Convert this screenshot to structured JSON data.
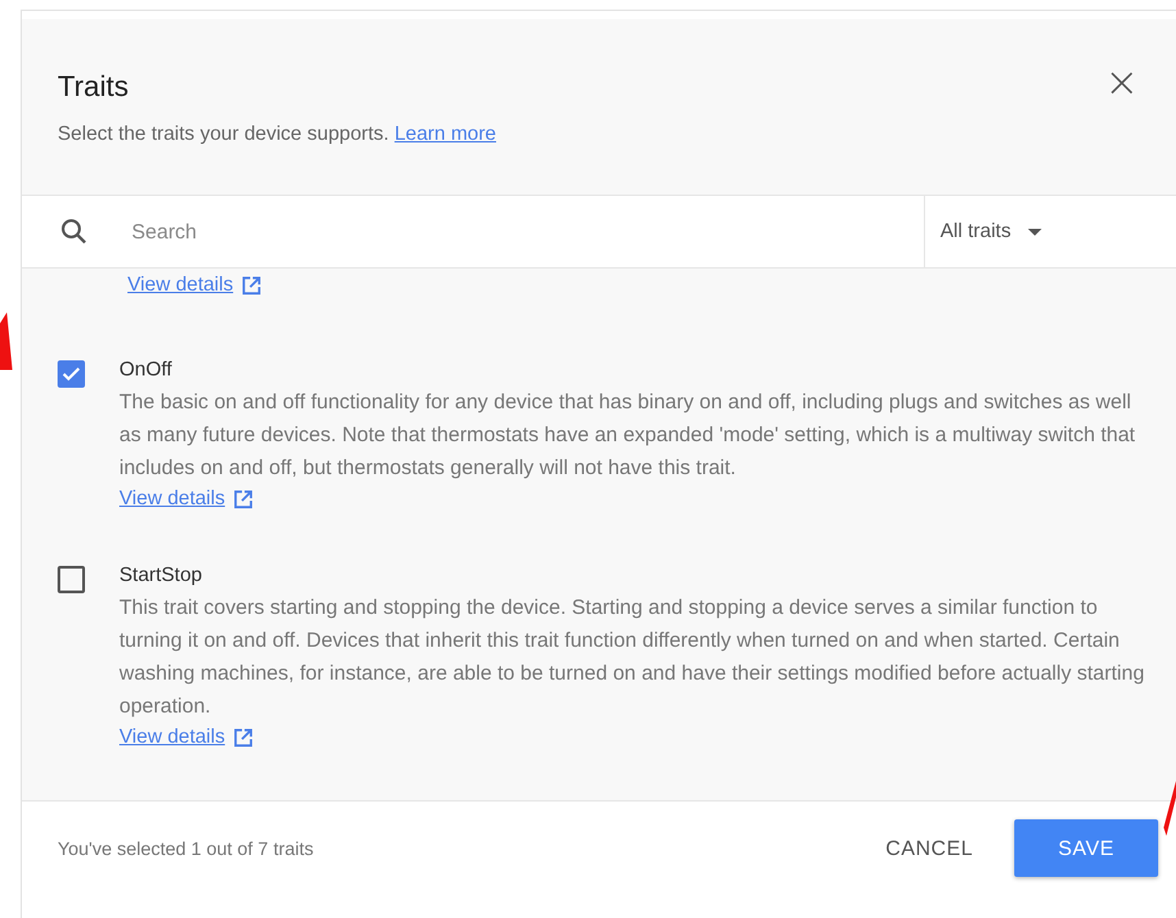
{
  "dialog": {
    "title": "Traits",
    "subtitle": "Select the traits your device supports.",
    "learn_more": "Learn more",
    "close": "×"
  },
  "search": {
    "placeholder": "Search",
    "filter": "All traits"
  },
  "partial_item": {
    "link": "View details"
  },
  "traits": [
    {
      "name": "OnOff",
      "checked": true,
      "description": "The basic on and off functionality for any device that has binary on and off, including plugs and switches as well as many future devices. Note that thermostats have an expanded 'mode' setting, which is a multiway switch that includes on and off, but thermostats generally will not have this trait.",
      "link": "View details"
    },
    {
      "name": "StartStop",
      "checked": false,
      "description": "This trait covers starting and stopping the device. Starting and stopping a device serves a similar function to turning it on and off. Devices that inherit this trait function differently when turned on and when started. Certain washing machines, for instance, are able to be turned on and have their settings modified before actually starting operation.",
      "link": "View details"
    }
  ],
  "footer": {
    "status": "You've selected 1 out of 7 traits",
    "cancel": "CANCEL",
    "save": "SAVE"
  }
}
